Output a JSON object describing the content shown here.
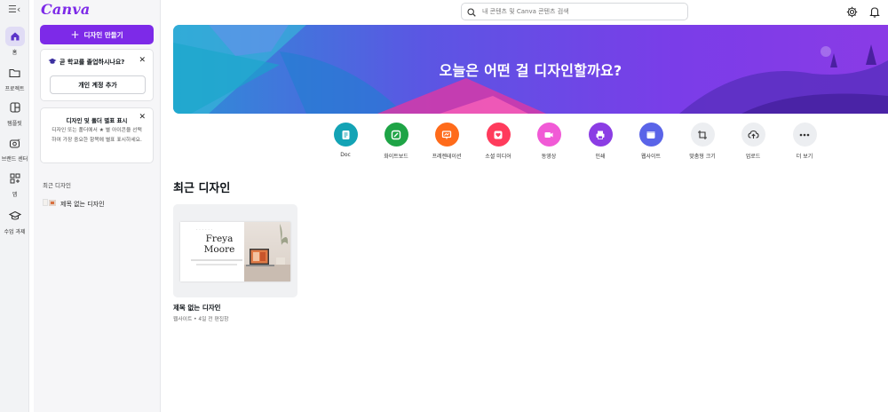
{
  "rail": {
    "items": [
      {
        "label": "홈",
        "icon": "home-icon"
      },
      {
        "label": "프로젝트",
        "icon": "folder-icon"
      },
      {
        "label": "템플릿",
        "icon": "template-icon"
      },
      {
        "label": "브랜드 센터",
        "icon": "brand-icon"
      },
      {
        "label": "앱",
        "icon": "apps-icon"
      },
      {
        "label": "수업 과제",
        "icon": "graduation-icon"
      }
    ]
  },
  "panel": {
    "logo": "Canva",
    "create_label": "디자인 만들기",
    "promo": {
      "message": "곧 학교를 졸업하시나요?",
      "button": "개인 계정 추가"
    },
    "tip": {
      "title": "디자인 및 폴더 별표 표시",
      "body": "디자인 또는 폴더에서 ★ 별 아이콘을 선택하여 가장 중요한 항목에 별표 표시하세요."
    },
    "recent_heading": "최근 디자인",
    "recent_items": [
      {
        "label": "제목 없는 디자인"
      }
    ]
  },
  "topbar": {
    "search_placeholder": "내 콘텐츠 및 Canva 콘텐츠 검색"
  },
  "banner": {
    "headline": "오늘은 어떤 걸 디자인할까요?"
  },
  "actions": [
    {
      "label": "Doc",
      "color": "#13a3b5",
      "icon": "doc-icon"
    },
    {
      "label": "화이트보드",
      "color": "#1ea446",
      "icon": "whiteboard-icon"
    },
    {
      "label": "프레젠테이션",
      "color": "#ff6b1a",
      "icon": "presentation-icon"
    },
    {
      "label": "소셜 미디어",
      "color": "#ff3b5c",
      "icon": "heart-icon"
    },
    {
      "label": "동영상",
      "color": "#f15ad6",
      "icon": "video-icon"
    },
    {
      "label": "인쇄",
      "color": "#8b3de4",
      "icon": "print-icon"
    },
    {
      "label": "웹사이트",
      "color": "#5a64e8",
      "icon": "website-icon"
    },
    {
      "label": "맞춤형 크기",
      "color": "#eceef1",
      "icon": "custom-size-icon"
    },
    {
      "label": "업로드",
      "color": "#eceef1",
      "icon": "upload-icon"
    },
    {
      "label": "더 보기",
      "color": "#eceef1",
      "icon": "more-icon"
    }
  ],
  "recent": {
    "title": "최근 디자인",
    "designs": [
      {
        "name": "제목 없는 디자인",
        "meta": "웹사이트 • 4일 전 편집함",
        "thumb_name": "Freya Moore"
      }
    ]
  },
  "colors": {
    "accent": "#7d2ae8"
  }
}
